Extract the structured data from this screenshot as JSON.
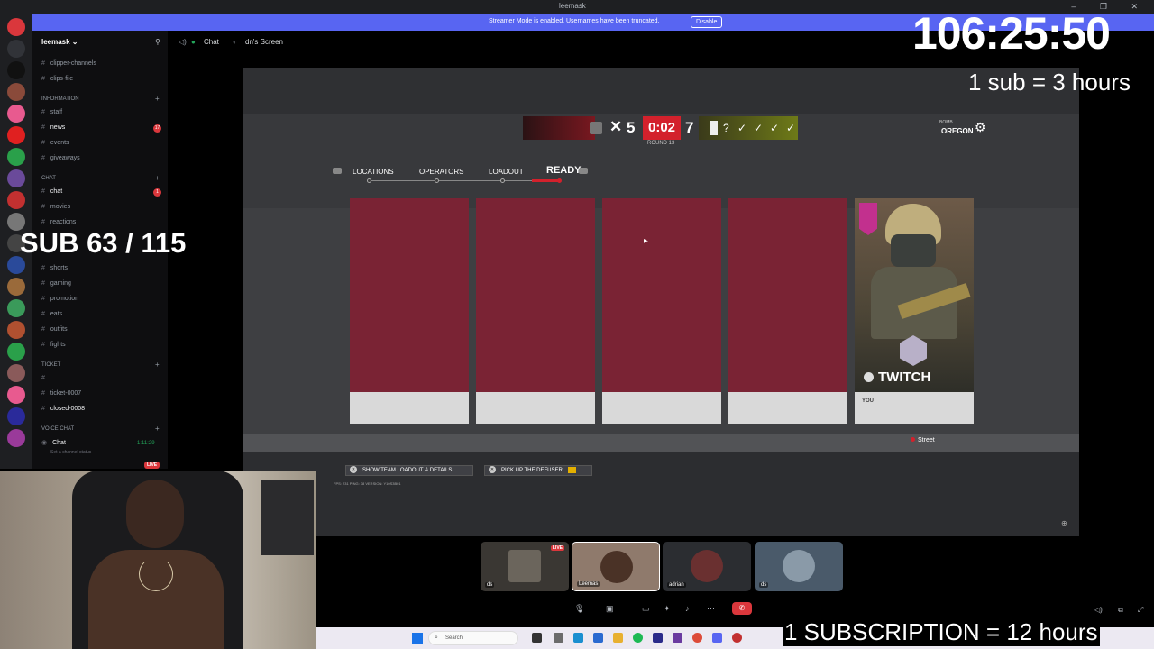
{
  "window": {
    "title": "leemask",
    "controls": "– ❐ ✕"
  },
  "streamer_mode": {
    "message": "Streamer Mode is enabled. Usernames have been truncated.",
    "disable_label": "Disable"
  },
  "server": {
    "name": "leemask ⌄"
  },
  "channels": {
    "items": [
      {
        "name": "clipper-channels"
      },
      {
        "name": "clips-file"
      },
      {
        "name": "staff"
      },
      {
        "name": "news",
        "badge": "17"
      },
      {
        "name": "events"
      },
      {
        "name": "giveaways"
      },
      {
        "name": "chat",
        "badge": "1"
      },
      {
        "name": "movies"
      },
      {
        "name": "reactions"
      },
      {
        "name": "shorts"
      },
      {
        "name": "gaming"
      },
      {
        "name": "promotion"
      },
      {
        "name": "eats"
      },
      {
        "name": "outfits"
      },
      {
        "name": "fights"
      },
      {
        "name": "ticket-0007"
      },
      {
        "name": "closed-0008"
      }
    ],
    "categories": {
      "information": "INFORMATION",
      "chat": "Chat",
      "ticket": "Ticket",
      "voice": "VOICE CHAT"
    },
    "voice_channel": "Chat",
    "voice_time": "1:11:29",
    "voice_status": "Set a channel status",
    "live": "LIVE"
  },
  "vc_header": {
    "channel": "Chat",
    "screen": "dn's Screen"
  },
  "game": {
    "score_left": "5",
    "timer": "0:02",
    "score_right": "7",
    "question": "?",
    "checks": [
      "✓",
      "✓",
      "✓",
      "✓"
    ],
    "round": "ROUND 13",
    "bomb": "BOMB",
    "map": "OREGON",
    "tabs": {
      "locations": "LOCATIONS",
      "operators": "OPERATORS",
      "loadout": "LOADOUT",
      "ready": "READY"
    },
    "operator": {
      "name": "TWITCH",
      "you": "YOU"
    },
    "site": "Street",
    "actions": {
      "loadout": "SHOW TEAM LOADOUT & DETAILS",
      "defuser": "PICK UP THE DEFUSER"
    },
    "fps": "FPS: 231     PING: 38     VERSION: Y10S3B01",
    "colors": {
      "team_red": "#7a2334",
      "timer_red": "#d3212c",
      "accent_yellow": "#e4b000"
    }
  },
  "overlay": {
    "timer": "106:25:50",
    "sub_rule_1": "1 sub = 3 hours",
    "sub_count": "SUB 63 / 115",
    "sub_rule_2": "1 SUBSCRIPTION = 12 hours"
  },
  "participants": [
    {
      "label": "ds",
      "live": "LIVE"
    },
    {
      "label": "Leemas"
    },
    {
      "label": "adrian"
    },
    {
      "label": "ds"
    }
  ],
  "taskbar": {
    "search_placeholder": "Search"
  }
}
